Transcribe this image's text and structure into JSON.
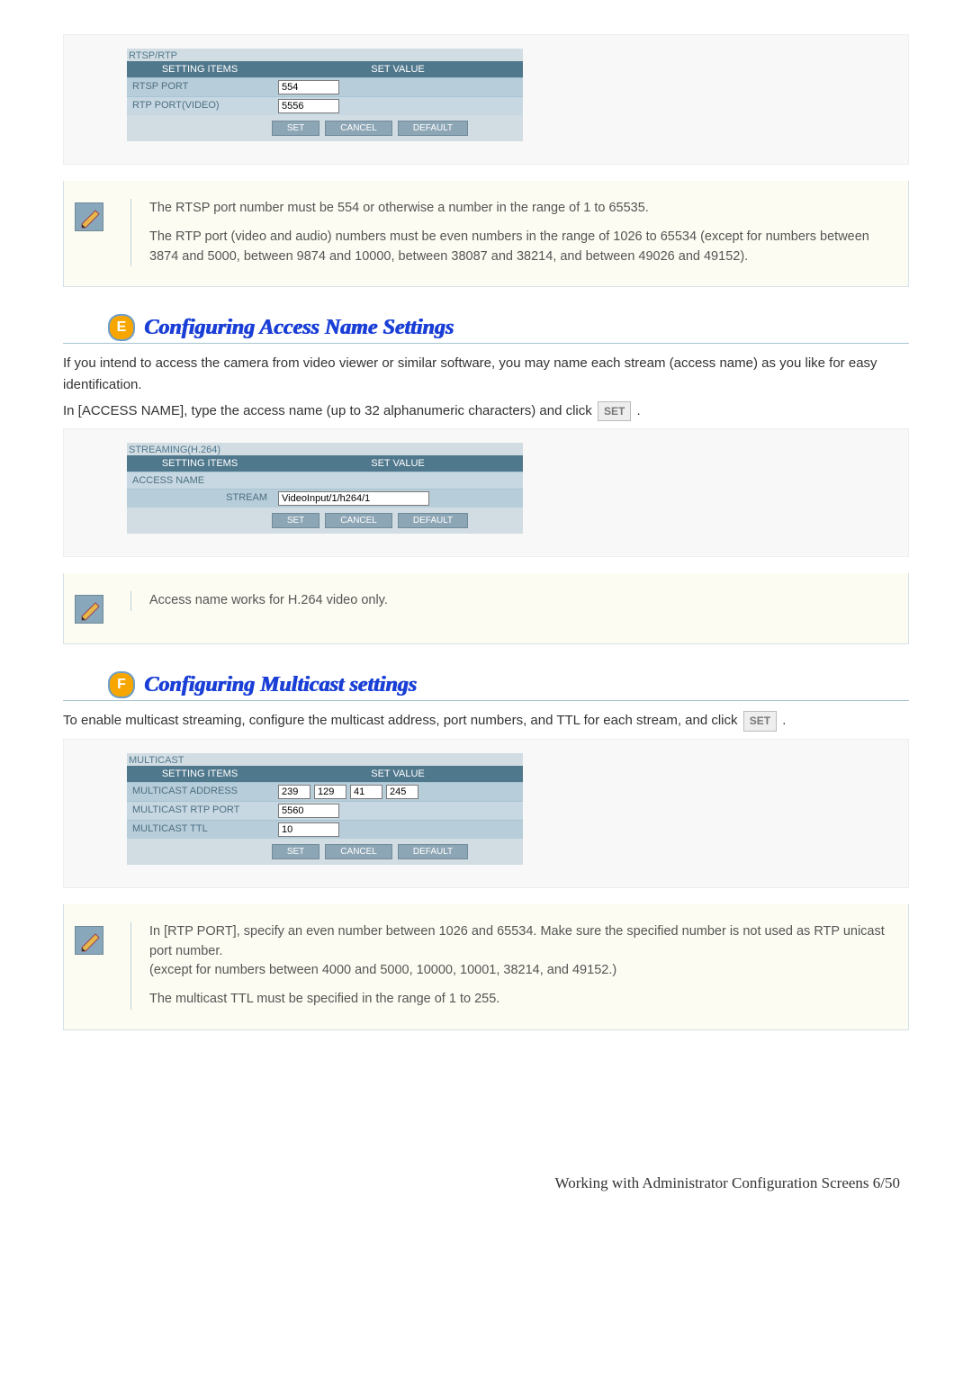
{
  "panel_rtsp": {
    "title": "RTSP/RTP",
    "head_items": "SETTING ITEMS",
    "head_value": "SET VALUE",
    "rows": [
      {
        "label": "RTSP PORT",
        "value": "554"
      },
      {
        "label": "RTP PORT(VIDEO)",
        "value": "5556"
      }
    ],
    "set": "SET",
    "cancel": "CANCEL",
    "default": "DEFAULT"
  },
  "note1": {
    "line1": "The RTSP port number must be 554 or otherwise a number in the range of 1 to 65535.",
    "line2": "The RTP port (video and audio) numbers must be even numbers in the range of 1026 to 65534 (except for numbers between 3874 and 5000, between 9874 and 10000, between 38087 and 38214, and between 49026 and 49152)."
  },
  "sectionE": {
    "badge": "E",
    "title": "Configuring Access Name Settings",
    "para1": "If you intend to access the camera from video viewer or similar software, you may name each stream (access name) as you like for easy identification.",
    "para2a": "In [ACCESS NAME], type the access name (up to 32 alphanumeric characters) and click ",
    "para2b": " ."
  },
  "panel_stream": {
    "title": "STREAMING(H.264)",
    "head_items": "SETTING ITEMS",
    "head_value": "SET VALUE",
    "subhead": "ACCESS NAME",
    "row_label": "STREAM",
    "row_value": "VideoInput/1/h264/1",
    "set": "SET",
    "cancel": "CANCEL",
    "default": "DEFAULT"
  },
  "note2": {
    "line1": "Access name works for H.264 video only."
  },
  "sectionF": {
    "badge": "F",
    "title": "Configuring Multicast settings",
    "para1a": "To enable multicast streaming, configure the multicast address, port numbers, and TTL for each stream, and click ",
    "para1b": " ."
  },
  "panel_multi": {
    "title": "MULTICAST",
    "head_items": "SETTING ITEMS",
    "head_value": "SET VALUE",
    "addr_label": "MULTICAST ADDRESS",
    "addr_oct": [
      "239",
      "129",
      "41",
      "245"
    ],
    "rtp_label": "MULTICAST RTP PORT",
    "rtp_value": "5560",
    "ttl_label": "MULTICAST TTL",
    "ttl_value": "10",
    "set": "SET",
    "cancel": "CANCEL",
    "default": "DEFAULT"
  },
  "note3": {
    "line1": "In [RTP PORT], specify an even number between 1026 and 65534. Make sure the specified number is not used as RTP unicast port number.",
    "line2": "(except for numbers between 4000 and 5000, 10000, 10001, 38214, and 49152.)",
    "line3": "The multicast TTL must be specified in the range of 1 to 255."
  },
  "setbtn": "SET",
  "footer": "Working with Administrator Configuration Screens 6/50"
}
